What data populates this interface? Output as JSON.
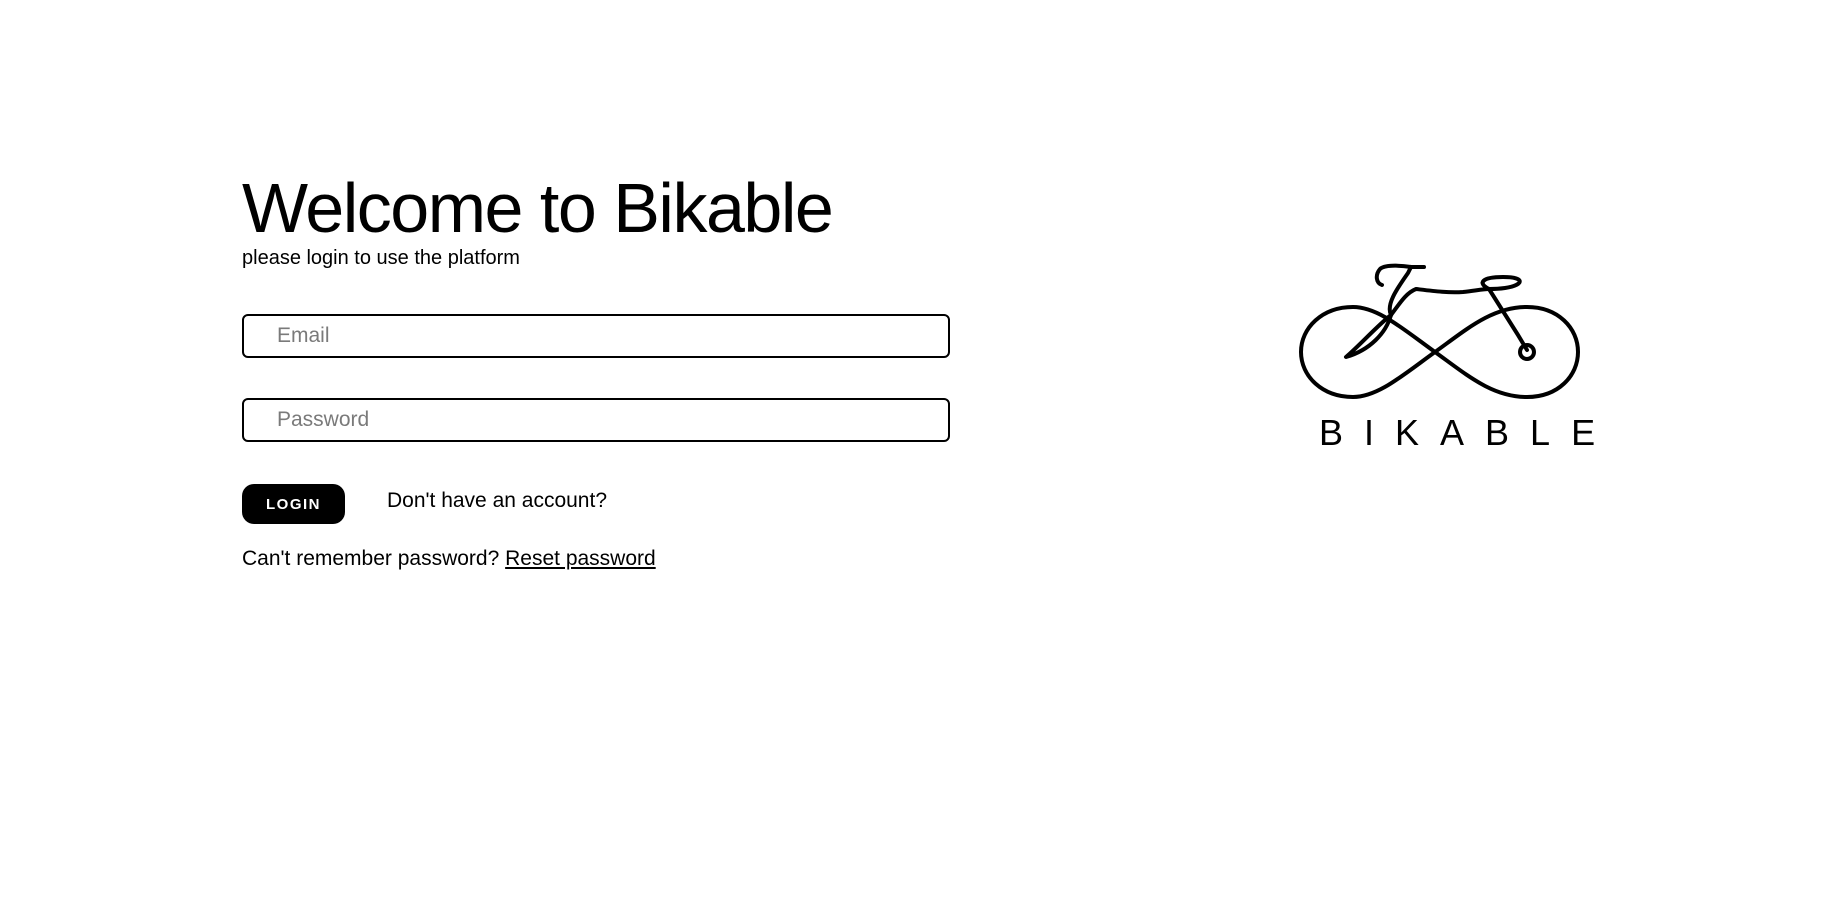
{
  "login": {
    "title": "Welcome to Bikable",
    "subtitle": "please login to use the platform",
    "email_placeholder": "Email",
    "password_placeholder": "Password",
    "login_label": "LOGIN",
    "signup_link": "Don't have an account?",
    "reset_prompt": "Can't remember password?",
    "reset_link": "Reset password"
  },
  "logo": {
    "icon": "bicycle-infinity-logo",
    "text": "BIKABLE"
  },
  "colors": {
    "background": "#ffffff",
    "foreground": "#000000",
    "button": "#000000",
    "button_text": "#ffffff"
  }
}
